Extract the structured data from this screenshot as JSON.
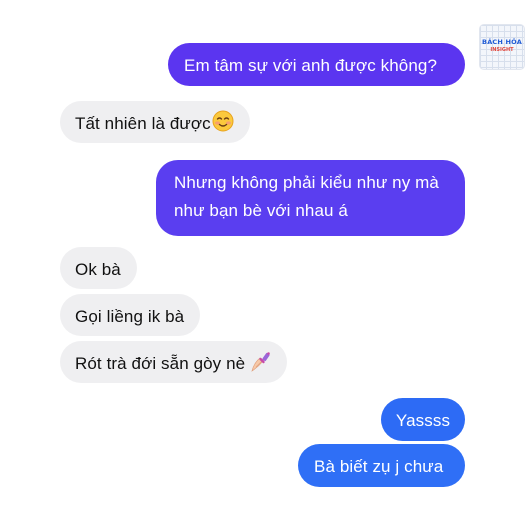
{
  "logo": {
    "line1": "BÁCH HÓA",
    "line2": "INSIGHT"
  },
  "messages": [
    {
      "side": "out",
      "text": "Em tâm sự với anh được không?"
    },
    {
      "side": "in",
      "text": "Tất nhiên là được",
      "emoji": "smiling-face"
    },
    {
      "side": "out",
      "text": "Nhưng không phải kiểu như ny mà như bạn bè với nhau á"
    },
    {
      "side": "in",
      "text": "Ok bà"
    },
    {
      "side": "in",
      "text": "Gọi liềng ik bà"
    },
    {
      "side": "in",
      "text": "Rót trà đới sẵn gòy nè",
      "emoji": "nail-polish"
    },
    {
      "side": "out",
      "text": "Yassss"
    },
    {
      "side": "out",
      "text": "Bà biết zụ j chưa"
    }
  ],
  "colors": {
    "incoming_bg": "#efeff1",
    "outgoing_purple": "#5b35f0",
    "outgoing_blue": "#2f6ff6"
  }
}
